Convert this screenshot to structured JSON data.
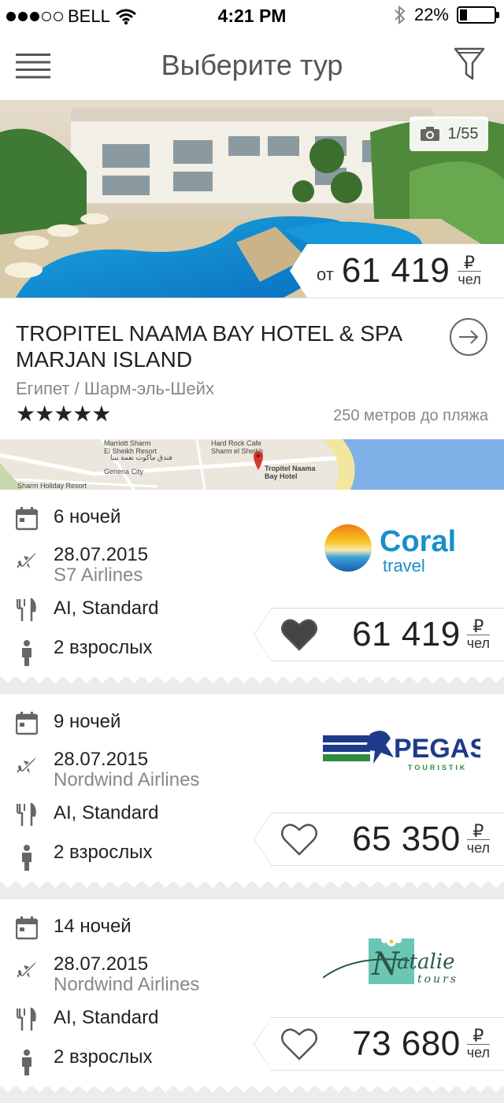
{
  "status_bar": {
    "carrier": "BELL",
    "time": "4:21 PM",
    "battery": "22%",
    "battery_level": 0.22
  },
  "header": {
    "title": "Выберите тур"
  },
  "hotel": {
    "photo_counter": "1/55",
    "price_prefix": "от",
    "price": "61 419",
    "currency": "₽",
    "per": "чел",
    "name": "TROPITEL NAAMA BAY HOTEL & SPA MARJAN ISLAND",
    "location": "Египет / Шарм-эль-Шейх",
    "stars": "★★★★★",
    "beach_distance": "250 метров до пляжа"
  },
  "map": {
    "label_marriott": "Marriott Sharm\nEl Sheikh Resort",
    "label_marriott_ar": "فندق ماكوت نعمة بيتا",
    "label_hardrock": "Hard Rock Cafe\nSharm el Sheikh",
    "label_hotel": "Tropitel Naama\nBay Hotel",
    "label_genena": "Genena City",
    "label_holiday": "Sharm Holiday Resort"
  },
  "offers": [
    {
      "nights": "6 ночей",
      "date": "28.07.2015",
      "airline": "S7 Airlines",
      "meal": "AI, Standard",
      "guests": "2  взрослых",
      "operator": "Coral travel",
      "price": "61 419",
      "currency": "₽",
      "per": "чел",
      "favorite": true
    },
    {
      "nights": "9 ночей",
      "date": "28.07.2015",
      "airline": "Nordwind Airlines",
      "meal": "AI, Standard",
      "guests": "2  взрослых",
      "operator": "PEGAS TOURISTIK",
      "price": "65 350",
      "currency": "₽",
      "per": "чел",
      "favorite": false
    },
    {
      "nights": "14 ночей",
      "date": "28.07.2015",
      "airline": "Nordwind Airlines",
      "meal": "AI, Standard",
      "guests": "2  взрослых",
      "operator": "Natalie tours",
      "price": "73 680",
      "currency": "₽",
      "per": "чел",
      "favorite": false
    }
  ],
  "colors": {
    "accent_dark": "#444444",
    "coral_blue": "#1a8fc9",
    "pegas_blue": "#1e3a8a",
    "pegas_green": "#2e8b3e",
    "map_water": "#7fb0e8",
    "map_marker": "#d9362b"
  }
}
